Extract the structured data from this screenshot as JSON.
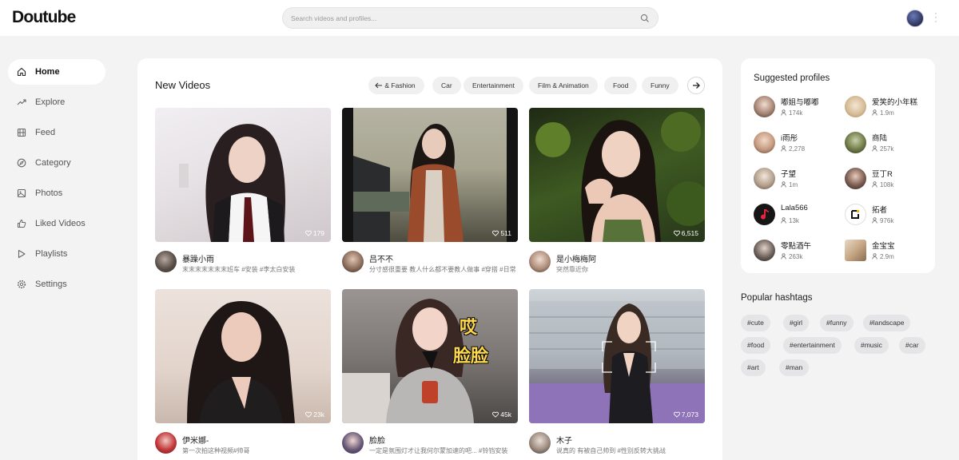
{
  "app": {
    "logo": "Doutube"
  },
  "search": {
    "placeholder": "Search videos and profiles..."
  },
  "sidebar": {
    "items": [
      {
        "label": "Home",
        "icon": "home-icon",
        "active": true
      },
      {
        "label": "Explore",
        "icon": "trending-icon"
      },
      {
        "label": "Feed",
        "icon": "film-icon"
      },
      {
        "label": "Category",
        "icon": "compass-icon"
      },
      {
        "label": "Photos",
        "icon": "image-icon"
      },
      {
        "label": "Liked Videos",
        "icon": "thumbs-up-icon"
      },
      {
        "label": "Playlists",
        "icon": "play-icon"
      },
      {
        "label": "Settings",
        "icon": "gear-icon"
      }
    ]
  },
  "main": {
    "title": "New Videos",
    "chips": [
      "& Fashion",
      "Car",
      "Entertainment",
      "Film & Animation",
      "Food",
      "Funny"
    ],
    "videos": [
      {
        "user": "暴躁小雨",
        "desc": "末末末末末末末班车 #安装 #李太白安装",
        "likes": "179"
      },
      {
        "user": "吕不不",
        "desc": "分寸感很重要 教人什么都不要教人做事 #穿搭 #日常",
        "likes": "511"
      },
      {
        "user": "是小梅梅阿",
        "desc": "突然靠近你",
        "likes": "6,515"
      },
      {
        "user": "伊米娜-",
        "desc": "第一次拍这种视频#帅哥",
        "likes": "23k"
      },
      {
        "user": "脸脸",
        "desc": "一定是氛围灯才让我何尔蒙加速的吧... #铃铛安装",
        "likes": "45k"
      },
      {
        "user": "木子",
        "desc": "说真的 有被自己帅到 #性别反转大挑战",
        "likes": "7,073"
      }
    ]
  },
  "profiles": {
    "title": "Suggested profiles",
    "items": [
      {
        "name": "嘟姐与嘟嘟",
        "count": "174k"
      },
      {
        "name": "爱笑的小年糕",
        "count": "1.9m"
      },
      {
        "name": "i雨彤",
        "count": "2,278"
      },
      {
        "name": "商陆",
        "count": "257k"
      },
      {
        "name": "子望",
        "count": "1m"
      },
      {
        "name": "豆丁R",
        "count": "108k"
      },
      {
        "name": "Lala566",
        "count": "13k"
      },
      {
        "name": "拓者",
        "count": "976k"
      },
      {
        "name": "零點酒午",
        "count": "263k"
      },
      {
        "name": "金宝宝",
        "count": "2.9m"
      }
    ]
  },
  "hashtags": {
    "title": "Popular hashtags",
    "items": [
      "#cute",
      "#girl",
      "#funny",
      "#landscape",
      "#food",
      "#entertainment",
      "#music",
      "#car",
      "#art",
      "#man"
    ]
  },
  "overlay": {
    "line1": "哎",
    "line2": "脸脸"
  }
}
